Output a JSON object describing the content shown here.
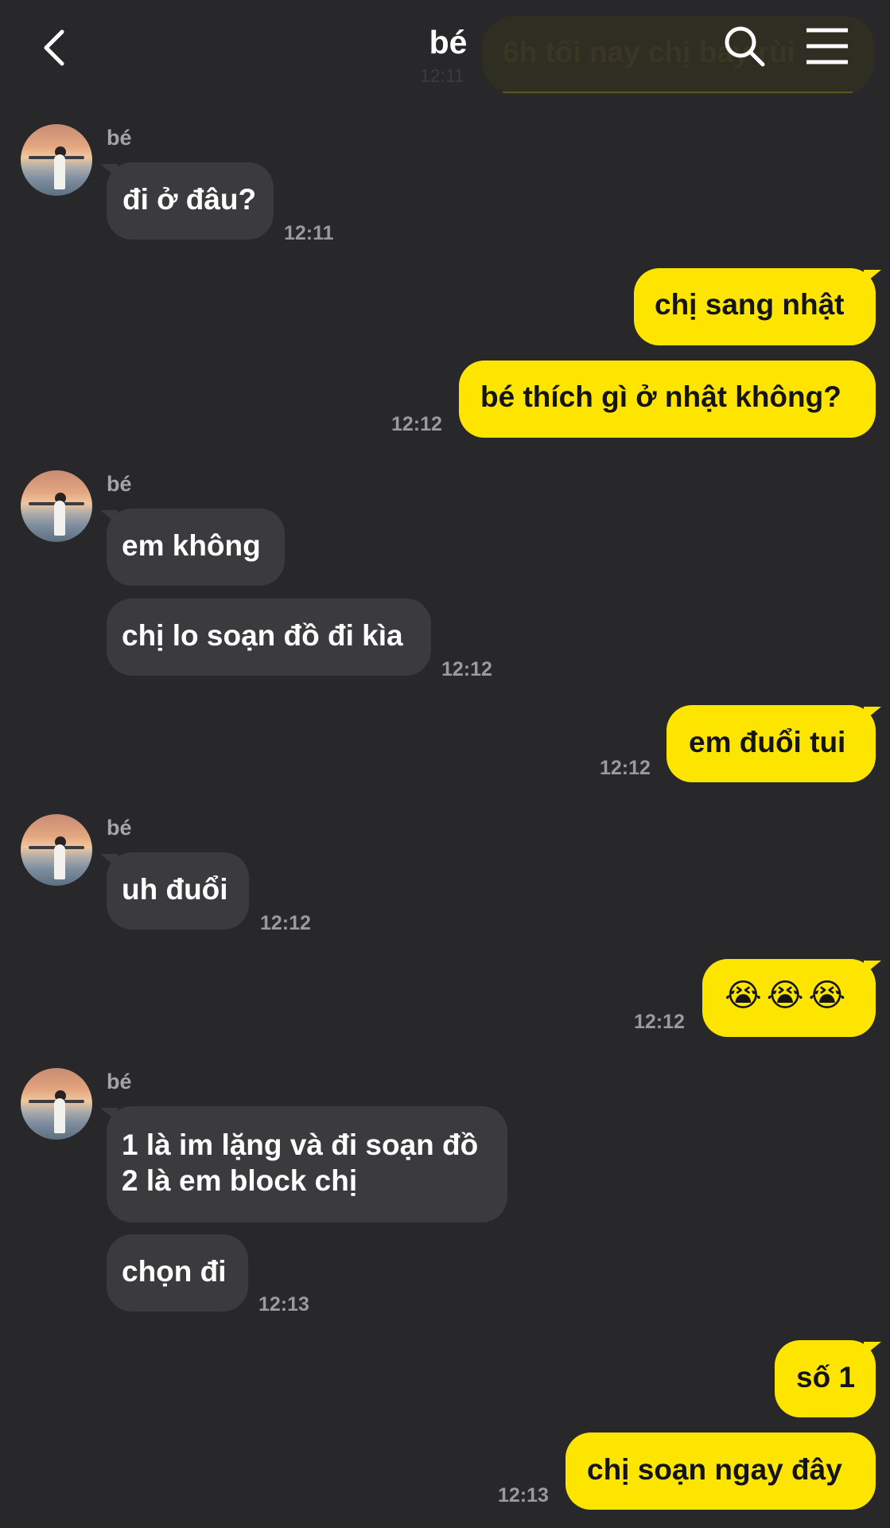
{
  "header": {
    "title": "bé",
    "overlay_preview_text": "6h tối nay chị bay rùi",
    "overlay_preview_time": "12:11"
  },
  "colors": {
    "background": "#28282a",
    "incoming_bubble": "#3b3b3e",
    "outgoing_bubble": "#fee500",
    "timestamp": "#9a9a9e"
  },
  "icons": {
    "back": "chevron-left-icon",
    "search": "search-icon",
    "menu": "hamburger-menu-icon"
  },
  "messages": [
    {
      "sender": "bé",
      "text": "đi ở đâu?",
      "time": "12:11"
    },
    {
      "text": "chị sang nhật"
    },
    {
      "text": "bé thích gì ở nhật không?",
      "time": "12:12"
    },
    {
      "sender": "bé",
      "text": "em không"
    },
    {
      "text": "chị lo soạn đồ đi kìa",
      "time": "12:12"
    },
    {
      "text": "em đuổi tui",
      "time": "12:12"
    },
    {
      "sender": "bé",
      "text": "uh đuổi",
      "time": "12:12"
    },
    {
      "text": "😭😭😭",
      "time": "12:12"
    },
    {
      "sender": "bé",
      "text_lines": [
        "1 là im lặng và đi soạn đồ",
        "2 là em block chị"
      ]
    },
    {
      "text": "chọn đi",
      "time": "12:13"
    },
    {
      "text": "số 1"
    },
    {
      "text": "chị soạn ngay đây",
      "time": "12:13"
    }
  ]
}
